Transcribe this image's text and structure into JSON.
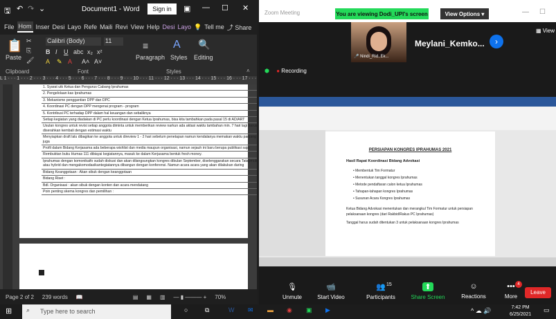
{
  "word": {
    "title": "Document1 - Word",
    "sign_in": "Sign in",
    "tabs": [
      "File",
      "Hom",
      "Inser",
      "Desi",
      "Layo",
      "Refe",
      "Maili",
      "Revi",
      "View",
      "Help",
      "Desi",
      "Layo"
    ],
    "tell_me": "Tell me",
    "share": "Share",
    "font_name": "Calibri (Body)",
    "font_size": "11",
    "paste": "Paste",
    "paragraph": "Paragraph",
    "styles": "Styles",
    "editing": "Editing",
    "group_clipboard": "Clipboard",
    "group_font": "Font",
    "group_styles": "Styles",
    "ruler": "L  1 · · · 1 · · · 2 · · · 3 · · · 4 · · · 5 · · · 6 · · · 7 · · · 8 · · · 9 · · · 10 · · · 11 · · · 12 · · · 13 · · · 14 · · · 15 · · · 16 · · · 17 · · · 18",
    "doc_lines": [
      "1.   Syarat utk Ketua dan Pengurus Cabang Iprahumas",
      "2.   Pengelolaan kas Iprahumas",
      "3.   Mekanisme penggantian DPP dan DPC",
      "4.   Koordinasi PC dengan DPP mengenai program - program",
      "5.   Kontribusi PC terhadap DPP dalam hal keuangan dan sebaliknya",
      "Setiap kegiatan yang diadakan di PC perlu koordinasi dengan Ketua Iprahumas, bisa kita tambahkan pada pasal 15 di AD/ART",
      "Usulan kongres untuk revisi setiap anggota diminta untuk memberikan review narkun ada aktasi waktu tambahan min. 7 hari lagi harus diserahkan kembali dengan estimasi waktu",
      "Menyiapkan draft lalu dibagikan ke anggota untuk direview 1 - 2 hari sebelum penetapan namun kendalanya memakan waktu panjang juga",
      "Profil dalam Bidang Kerjasama ada beberapa wishlist dan media maupun organisasi, namun sejauh ini baru berupa publikasi saja",
      "Rembuktan buku Humas 111 dibiayai kegiatannya, masuk ke dalam Kerjasama bentuk fresh money.",
      "Iprahumas dengan komonikaifo sudah diskusi dan akan dilangsungkan kongres dibulan September, diselenggarakan secara Tatapmuka atau hybrid dan mengakomodasikantegiatannya dibangun dengan konferensi. Namun acara acara yang akan dilakukan daring",
      "Bidang Keanggotaan : Akan sibuk dengan keanggotaan",
      "Bidang Riset :",
      "Bdl. Organisasi : akan sibuk dengan konten dan acara mendatang",
      "Poin penting skema kongres dan pemilihan :"
    ],
    "status_page": "Page 2 of 2",
    "status_words": "239 words",
    "zoom_level": "70%"
  },
  "zoom": {
    "app_title": "Zoom Meeting",
    "banner": "You are viewing Dodi_UPI's screen",
    "view_options": "View Options ▾",
    "view_label": "View",
    "participant_name": "Meylani_Kemko...",
    "tile_name": "Nindi_Rid..Ek...",
    "recording": "Recording",
    "shared_doc": {
      "title": "PERSIAPAN KONGRES IPRAHUMAS 2021",
      "subtitle": "Hasil Rapat Koordinasi Bidang Advokasi",
      "bullets": [
        "Membentuk Tim Formatur",
        "Menentukan tanggal kongres Iprahumas",
        "Metode pendaftaran calon ketua Iprahumas",
        "Tahapan-tahapan kongres Iprahumas",
        "Susunan Acara Kongres Iprahumas"
      ],
      "numbered": [
        "Ketua Bidang Advokasi menentukan dan merangkul Tim Formatur untuk persiapan pelaksanaan kongres (dari Rakbid/Rakus PC Iprahumas)",
        "Tanggal harus sudah ditentukan 3 untuk pelaksanaan kongres Iprahumas"
      ]
    },
    "toolbar": [
      {
        "label": "Unmute",
        "icon": "mic-off-icon"
      },
      {
        "label": "Start Video",
        "icon": "video-off-icon"
      },
      {
        "label": "Participants",
        "icon": "participants-icon",
        "count": "15"
      },
      {
        "label": "Share Screen",
        "icon": "share-screen-icon"
      },
      {
        "label": "Reactions",
        "icon": "reactions-icon"
      },
      {
        "label": "More",
        "icon": "more-icon",
        "badge": "4"
      }
    ],
    "leave": "Leave"
  },
  "taskbar": {
    "search_placeholder": "Type here to search",
    "time": "7:42 PM",
    "date": "6/25/2021"
  },
  "colors": {
    "zoom_green": "#23d959",
    "zoom_blue": "#0e72ed",
    "share_green": "#23d959",
    "leave_red": "#e02828",
    "word_blue": "#2b579a"
  }
}
